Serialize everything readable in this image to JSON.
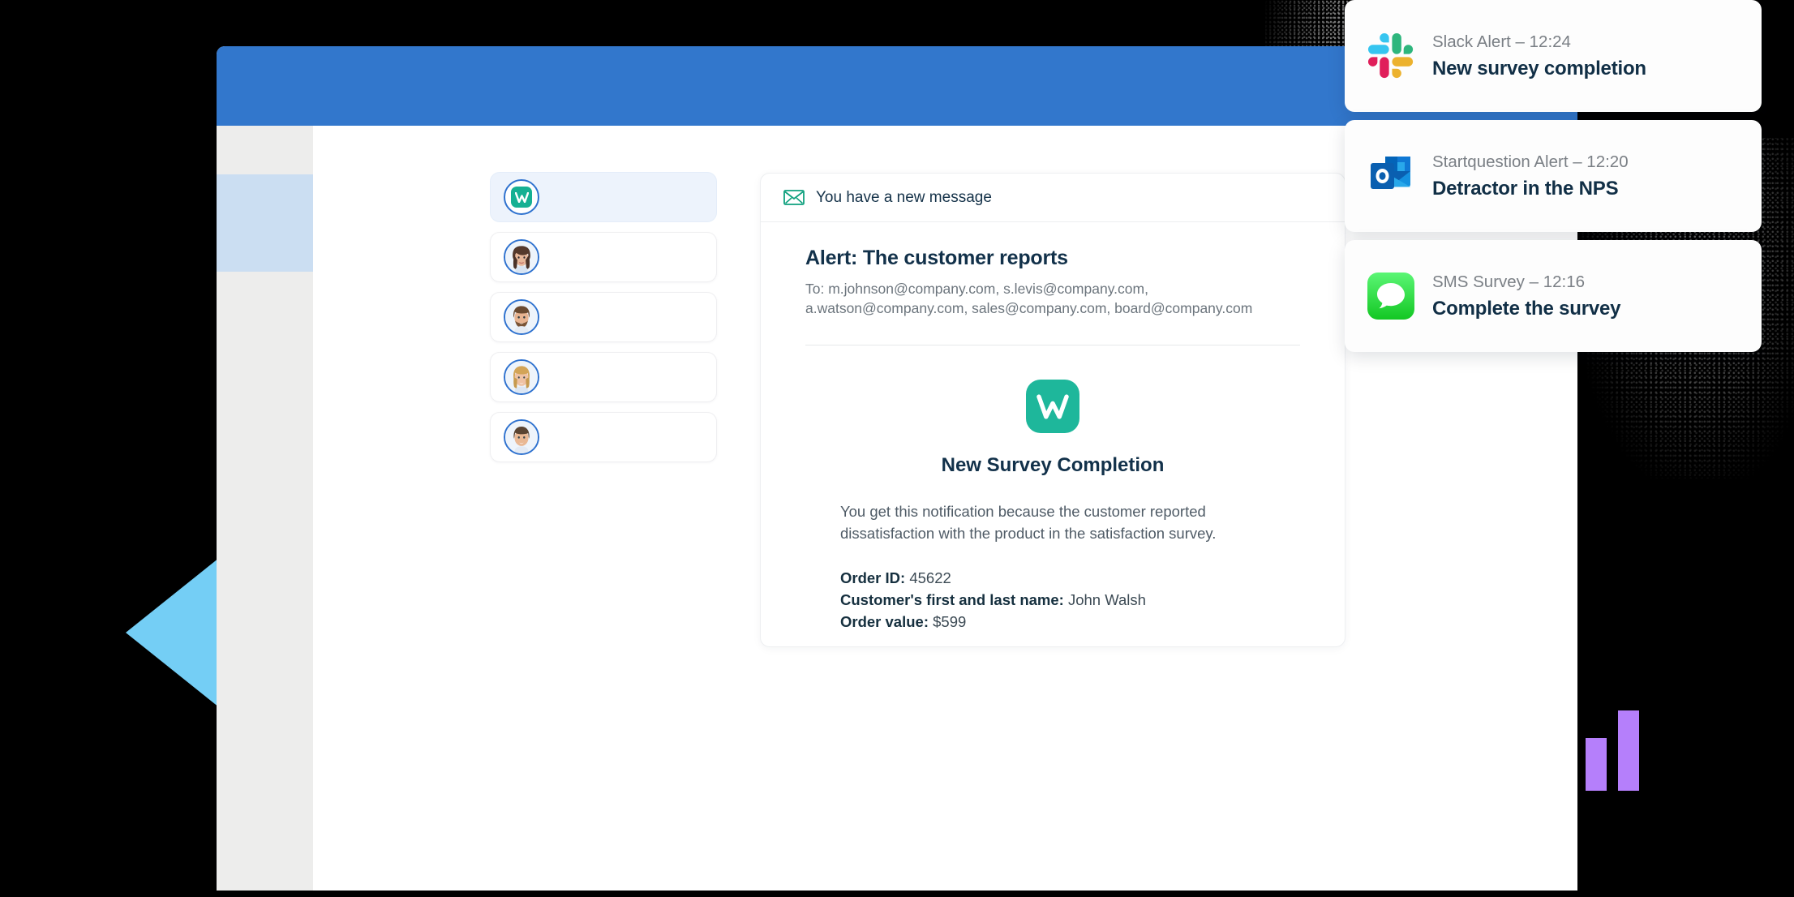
{
  "colors": {
    "titlebar": "#3277CC",
    "rail": "#EDEDEC",
    "rail_highlight": "#CBDEF2",
    "brand_teal": "#16B093",
    "logo_teal": "#1EB79B",
    "avatar_ring": "#2F72CF",
    "wedge_blue": "#74CEF5",
    "bar_purple": "#B57FFB",
    "heading": "#12314A",
    "muted": "#6C757D"
  },
  "window": {
    "rail": {
      "name": "navigation-rail"
    },
    "conversations": [
      {
        "id": "brand",
        "type": "brand",
        "active": true,
        "icon": "startquestion-logo-icon"
      },
      {
        "id": "c1",
        "type": "avatar",
        "active": false,
        "icon": "avatar-woman-brunette"
      },
      {
        "id": "c2",
        "type": "avatar",
        "active": false,
        "icon": "avatar-man-beard"
      },
      {
        "id": "c3",
        "type": "avatar",
        "active": false,
        "icon": "avatar-woman-blonde"
      },
      {
        "id": "c4",
        "type": "avatar",
        "active": false,
        "icon": "avatar-man-short-hair"
      }
    ],
    "email": {
      "header_label": "You have a new message",
      "header_icon": "envelope-icon",
      "subject": "Alert: The customer reports",
      "recipients": "To: m.johnson@company.com, s.levis@company.com, a.watson@company.com, sales@company.com, board@company.com",
      "logo_icon": "startquestion-logo-icon",
      "title": "New Survey Completion",
      "paragraph": "You get this notification because the customer reported dissatisfaction with the product in the satisfaction survey.",
      "details": [
        {
          "label": "Order ID:",
          "value": "45622"
        },
        {
          "label": "Customer's first and last name:",
          "value": "John Walsh"
        },
        {
          "label": "Order value:",
          "value": "$599"
        }
      ]
    }
  },
  "notifications": [
    {
      "icon": "slack-icon",
      "meta": "Slack Alert – 12:24",
      "title": "New survey completion"
    },
    {
      "icon": "outlook-icon",
      "meta": "Startquestion Alert – 12:20",
      "title": "Detractor in the NPS"
    },
    {
      "icon": "messages-icon",
      "meta": "SMS Survey – 12:16",
      "title": "Complete the survey"
    }
  ],
  "decorations": {
    "wedge": {
      "icon": "pie-wedge-shape",
      "color": "#74CEF5"
    },
    "bars": {
      "icon": "bar-chart-shape",
      "color": "#B57FFB",
      "heights": [
        32,
        65,
        99
      ]
    }
  }
}
